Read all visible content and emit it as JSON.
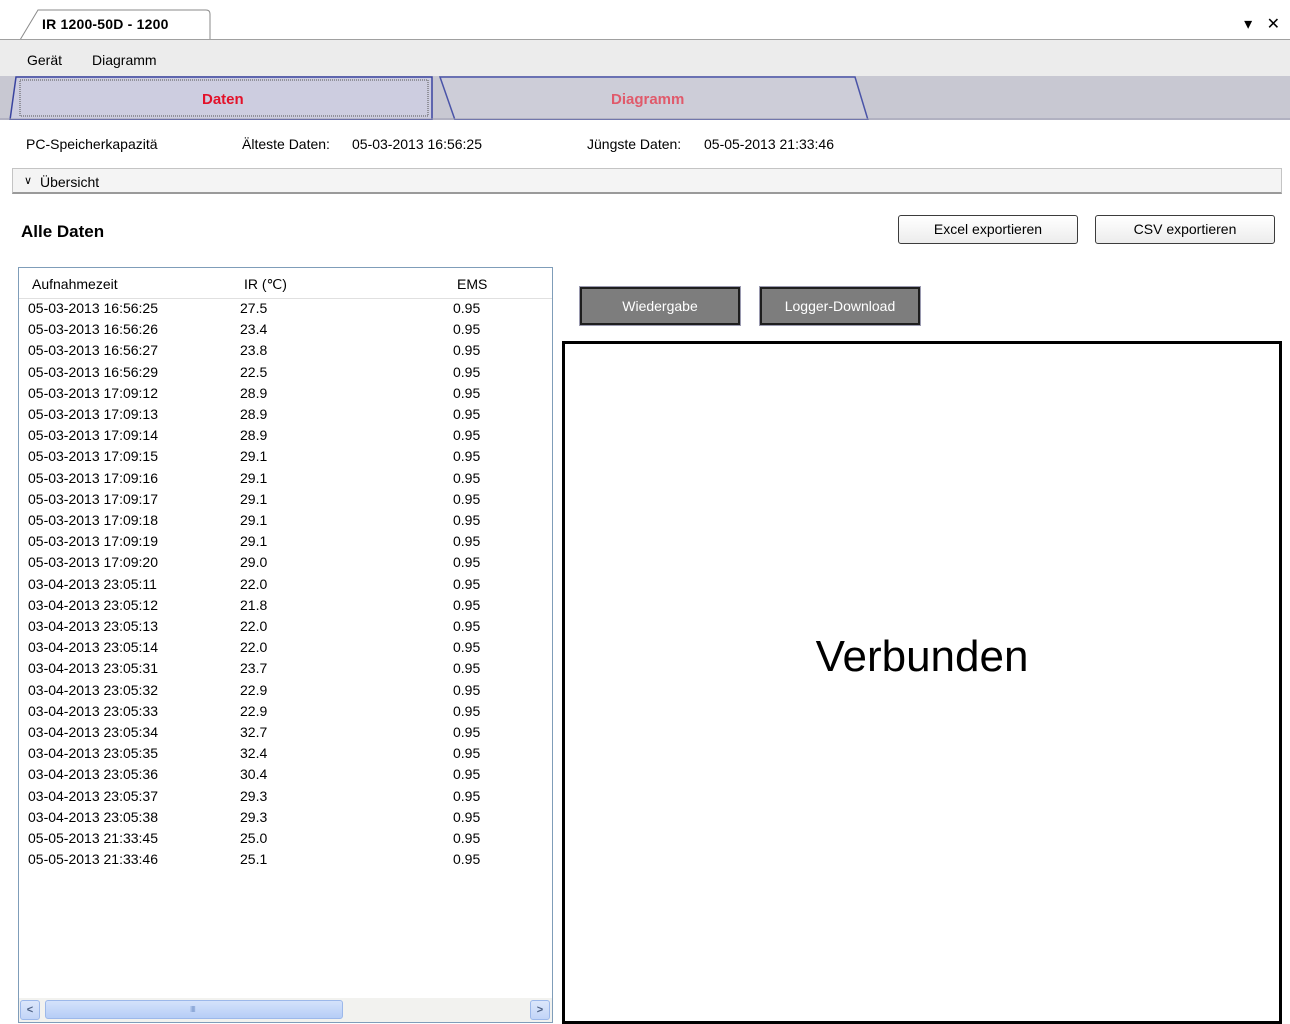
{
  "window": {
    "doc_tab": "IR 1200-50D - 1200",
    "dropdown_icon": "▾",
    "close_icon": "✕"
  },
  "menu": {
    "items": [
      "Gerät",
      "Diagramm"
    ]
  },
  "tabs": [
    {
      "label": "Daten",
      "active": true,
      "color": "#e3122a"
    },
    {
      "label": "Diagramm",
      "active": false,
      "color": "#e05a6b"
    }
  ],
  "info": {
    "capacity_label": "PC-Speicherkapazitä",
    "oldest_label": "Älteste Daten:",
    "oldest_value": "05-03-2013 16:56:25",
    "newest_label": "Jüngste Daten:",
    "newest_value": "05-05-2013 21:33:46"
  },
  "overview": {
    "icon": "chevrons-down-icon",
    "label": "Übersicht"
  },
  "section_title": "Alle Daten",
  "buttons": {
    "excel": "Excel exportieren",
    "csv": "CSV exportieren",
    "playback": "Wiedergabe",
    "logger": "Logger-Download"
  },
  "table": {
    "headers": [
      "Aufnahmezeit",
      "IR (℃)",
      "EMS"
    ],
    "rows": [
      [
        "05-03-2013 16:56:25",
        "27.5",
        "0.95"
      ],
      [
        "05-03-2013 16:56:26",
        "23.4",
        "0.95"
      ],
      [
        "05-03-2013 16:56:27",
        "23.8",
        "0.95"
      ],
      [
        "05-03-2013 16:56:29",
        "22.5",
        "0.95"
      ],
      [
        "05-03-2013 17:09:12",
        "28.9",
        "0.95"
      ],
      [
        "05-03-2013 17:09:13",
        "28.9",
        "0.95"
      ],
      [
        "05-03-2013 17:09:14",
        "28.9",
        "0.95"
      ],
      [
        "05-03-2013 17:09:15",
        "29.1",
        "0.95"
      ],
      [
        "05-03-2013 17:09:16",
        "29.1",
        "0.95"
      ],
      [
        "05-03-2013 17:09:17",
        "29.1",
        "0.95"
      ],
      [
        "05-03-2013 17:09:18",
        "29.1",
        "0.95"
      ],
      [
        "05-03-2013 17:09:19",
        "29.1",
        "0.95"
      ],
      [
        "05-03-2013 17:09:20",
        "29.0",
        "0.95"
      ],
      [
        "03-04-2013 23:05:11",
        "22.0",
        "0.95"
      ],
      [
        "03-04-2013 23:05:12",
        "21.8",
        "0.95"
      ],
      [
        "03-04-2013 23:05:13",
        "22.0",
        "0.95"
      ],
      [
        "03-04-2013 23:05:14",
        "22.0",
        "0.95"
      ],
      [
        "03-04-2013 23:05:31",
        "23.7",
        "0.95"
      ],
      [
        "03-04-2013 23:05:32",
        "22.9",
        "0.95"
      ],
      [
        "03-04-2013 23:05:33",
        "22.9",
        "0.95"
      ],
      [
        "03-04-2013 23:05:34",
        "32.7",
        "0.95"
      ],
      [
        "03-04-2013 23:05:35",
        "32.4",
        "0.95"
      ],
      [
        "03-04-2013 23:05:36",
        "30.4",
        "0.95"
      ],
      [
        "03-04-2013 23:05:37",
        "29.3",
        "0.95"
      ],
      [
        "03-04-2013 23:05:38",
        "29.3",
        "0.95"
      ],
      [
        "05-05-2013 21:33:45",
        "25.0",
        "0.95"
      ],
      [
        "05-05-2013 21:33:46",
        "25.1",
        "0.95"
      ]
    ]
  },
  "scrollbar": {
    "left_arrow": "<",
    "right_arrow": ">",
    "grip": "IIII"
  },
  "status": {
    "text": "Verbunden"
  }
}
